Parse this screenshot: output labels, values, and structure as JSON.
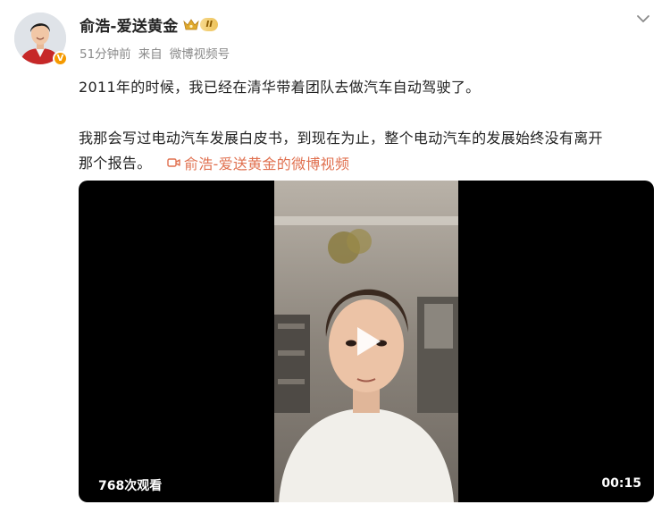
{
  "user": {
    "name": "俞浩-爱送黄金",
    "vip_level": "II",
    "verified_badge": "V"
  },
  "meta": {
    "time": "51分钟前",
    "source_prefix": "来自",
    "source": "微博视频号"
  },
  "post": {
    "line1": "2011年的时候，我已经在清华带着团队去做汽车自动驾驶了。",
    "line2": "我那会写过电动汽车发展白皮书，到现在为止，整个电动汽车的发展始终没有离开",
    "line3": "那个报告。",
    "video_link": "俞浩-爱送黄金的微博视频"
  },
  "video": {
    "views": "768次观看",
    "duration": "00:15"
  },
  "icons": {
    "menu": "chevron-down-icon",
    "play": "play-icon",
    "video_link": "video-camera-icon",
    "crown": "crown-icon"
  },
  "colors": {
    "link": "#e0704f",
    "meta": "#8a8a8a",
    "vip_gold": "#eec35a",
    "verified": "#f59a00"
  }
}
